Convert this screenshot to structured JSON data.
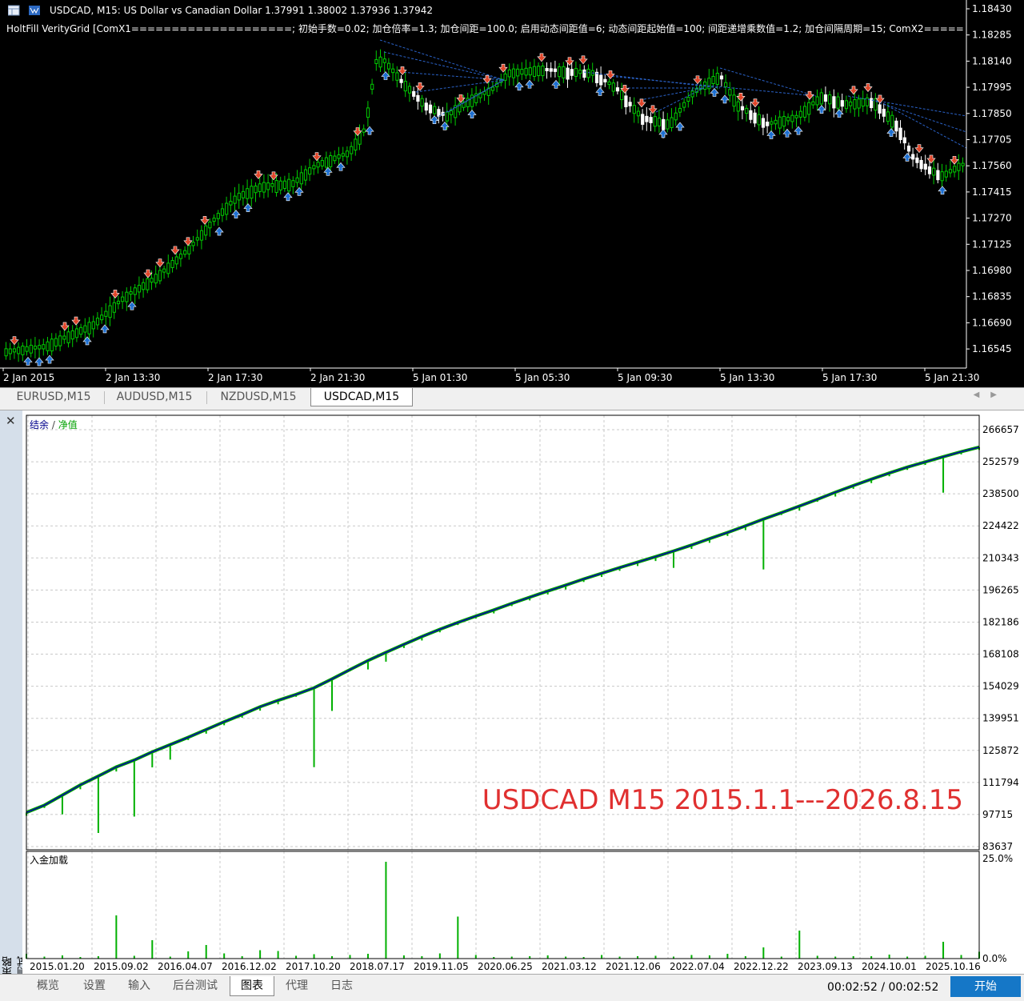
{
  "chart": {
    "title": "USDCAD, M15:  US Dollar vs Canadian Dollar  1.37991 1.38002 1.37936 1.37942",
    "indicator_params": "HoltFill VerityGrid  [ComX1====================; 初始手数=0.02; 加仓倍率=1.3; 加仓间距=100.0; 启用动态间距值=6; 动态间距起始值=100; 间距递增乘数值=1.2; 加仓间隔周期=15; ComX2==========",
    "price_axis": [
      "1.18430",
      "1.18285",
      "1.18140",
      "1.17995",
      "1.17850",
      "1.17705",
      "1.17560",
      "1.17415",
      "1.17270",
      "1.17125",
      "1.16980",
      "1.16835",
      "1.16690",
      "1.16545"
    ],
    "time_axis": [
      "2 Jan 2015",
      "2 Jan 13:30",
      "2 Jan 17:30",
      "2 Jan 21:30",
      "5 Jan 01:30",
      "5 Jan 05:30",
      "5 Jan 09:30",
      "5 Jan 13:30",
      "5 Jan 17:30",
      "5 Jan 21:30"
    ],
    "colors": {
      "bull": "#00cc00",
      "bear": "#ffffff",
      "buy_arrow": "#1e6fd0",
      "sell_arrow": "#e0462a",
      "trend_line": "#2a62c8"
    }
  },
  "symbol_tabs": [
    {
      "label": "EURUSD,M15",
      "selected": false
    },
    {
      "label": "AUDUSD,M15",
      "selected": false
    },
    {
      "label": "NZDUSD,M15",
      "selected": false
    },
    {
      "label": "USDCAD,M15",
      "selected": true
    }
  ],
  "tester": {
    "legend_balance": "结余",
    "legend_sep": " / ",
    "legend_equity": "净值",
    "annotation": "USDCAD M15 2015.1.1---2026.8.15",
    "side_label": "策略测试",
    "load_label": "入金加载",
    "load_axis": [
      "25.0%",
      "0.0%"
    ]
  },
  "chart_data": [
    {
      "type": "line",
      "title": "",
      "series": [
        {
          "name": "结余",
          "color": "#0000b0",
          "values": [
            98600,
            101800,
            106200,
            110700,
            114600,
            118600,
            121600,
            125200,
            128400,
            131600,
            135000,
            138400,
            141600,
            145000,
            147800,
            150400,
            153300,
            157200,
            161300,
            165300,
            168900,
            172400,
            175800,
            179000,
            182000,
            184800,
            187500,
            190400,
            193100,
            195800,
            198400,
            201100,
            203600,
            206100,
            208500,
            210900,
            213400,
            216000,
            218800,
            221500,
            224400,
            227400,
            230200,
            233100,
            236100,
            239200,
            242100,
            244900,
            247600,
            250200,
            252500,
            254800,
            257000,
            259000
          ]
        },
        {
          "name": "净值",
          "color": "#00b000",
          "values": [
            97200,
            100600,
            97800,
            108800,
            89600,
            116600,
            96800,
            118400,
            121800,
            130400,
            133200,
            136900,
            140200,
            143300,
            146100,
            149400,
            118500,
            143200,
            160600,
            161400,
            164800,
            170800,
            174100,
            177700,
            180900,
            183800,
            186000,
            189200,
            191700,
            194300,
            196500,
            199800,
            202000,
            204700,
            206800,
            209000,
            206000,
            214300,
            217000,
            220000,
            222500,
            205300,
            229200,
            231100,
            235000,
            237300,
            240700,
            243200,
            246200,
            249000,
            251200,
            239000,
            255800,
            257800
          ]
        }
      ],
      "x_ticks": [
        "2015.01.20",
        "2015.09.02",
        "2016.04.07",
        "2016.12.02",
        "2017.10.20",
        "2018.07.17",
        "2019.11.05",
        "2020.06.25",
        "2021.03.12",
        "2021.12.06",
        "2022.07.04",
        "2022.12.22",
        "2023.09.13",
        "2024.10.01",
        "2025.10.16"
      ],
      "y_ticks": [
        266657,
        252579,
        238500,
        224422,
        210343,
        196265,
        182186,
        168108,
        154029,
        139951,
        125872,
        111794,
        97715,
        83637
      ],
      "ylim": [
        83637,
        266657
      ]
    },
    {
      "type": "bar",
      "title": "",
      "series": [
        {
          "name": "入金加载",
          "values": [
            1.2,
            0.5,
            0.8,
            0.4,
            0.6,
            10.8,
            0.7,
            4.6,
            0.5,
            1.8,
            3.4,
            1.3,
            0.6,
            2.1,
            1.9,
            0.7,
            1.1,
            0.6,
            0.9,
            1.2,
            24.2,
            0.8,
            0.6,
            1.3,
            10.5,
            0.9,
            0.4,
            0.5,
            0.6,
            0.8,
            0.5,
            0.4,
            0.9,
            0.5,
            0.6,
            0.7,
            0.5,
            0.9,
            0.8,
            1.2,
            0.6,
            2.8,
            0.5,
            7.0,
            0.7,
            0.5,
            0.6,
            0.6,
            1.0,
            0.5,
            0.7,
            4.2,
            0.9,
            1.7
          ]
        }
      ],
      "ylim": [
        0,
        25
      ]
    }
  ],
  "bottom_tabs": [
    {
      "label": "概览",
      "selected": false
    },
    {
      "label": "设置",
      "selected": false
    },
    {
      "label": "输入",
      "selected": false
    },
    {
      "label": "后台测试",
      "selected": false
    },
    {
      "label": "图表",
      "selected": true
    },
    {
      "label": "代理",
      "selected": false
    },
    {
      "label": "日志",
      "selected": false
    }
  ],
  "timer": "00:02:52 / 00:02:52",
  "start_button": "开始"
}
